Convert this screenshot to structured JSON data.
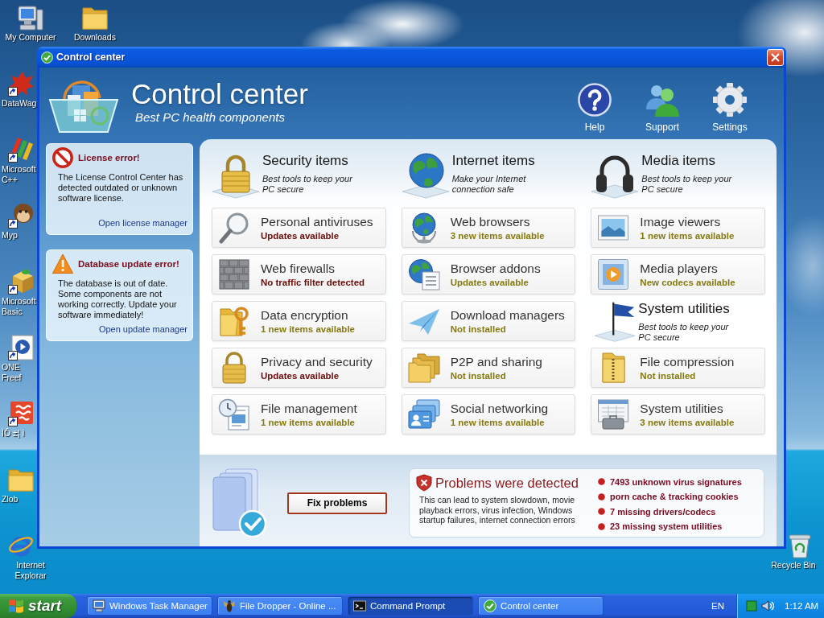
{
  "desktop": {
    "left_icons": [
      {
        "kind": "computer",
        "lines": [
          "My Computer"
        ]
      },
      {
        "kind": "splash",
        "lines": [
          "DataWag"
        ]
      },
      {
        "kind": "blocks",
        "lines": [
          "Microsoft",
          "C++"
        ]
      },
      {
        "kind": "monkey",
        "lines": [
          "Myp"
        ]
      },
      {
        "kind": "package",
        "lines": [
          "Microsoft",
          "Basic"
        ]
      },
      {
        "kind": "disc",
        "lines": [
          "ONE",
          "Freef"
        ]
      },
      {
        "kind": "tile",
        "lines": [
          "ÌÔ ±¦ ì"
        ]
      },
      {
        "kind": "folder",
        "lines": [
          "Zlob"
        ]
      },
      {
        "kind": "browser",
        "lines": [
          "Internet",
          "Explorar"
        ]
      }
    ],
    "top_icons": [
      {
        "kind": "folder",
        "lines": [
          "Downloads"
        ]
      }
    ],
    "right_icons": [
      {
        "kind": "bin",
        "lines": [
          "Recycle Bin"
        ]
      }
    ]
  },
  "window": {
    "title": "Control center",
    "header": {
      "title": "Control center",
      "subtitle": "Best PC health components",
      "tools": [
        {
          "kind": "help",
          "label": "Help"
        },
        {
          "kind": "support",
          "label": "Support"
        },
        {
          "kind": "settings",
          "label": "Settings"
        }
      ]
    },
    "alerts": [
      {
        "kind": "error",
        "title": "License error!",
        "text": "The License Control Center has detected outdated or unknown software license.",
        "link": "Open license manager"
      },
      {
        "kind": "warning",
        "title": "Database update error!",
        "text": "The database is out of date. Some components are not working correctly. Update your software immediately!",
        "link": "Open update manager"
      }
    ],
    "columns": [
      {
        "sections": [
          {
            "kind": "security",
            "title": "Security items",
            "description": "Best tools to keep your PC secure",
            "items": [
              {
                "kind": "antivirus",
                "name": "Personal antiviruses",
                "status": "Updates available",
                "color": "#6e0c0c"
              },
              {
                "kind": "firewall",
                "name": "Web firewalls",
                "status": "No traffic filter detected",
                "color": "#6e0c0c"
              },
              {
                "kind": "encryption",
                "name": "Data encryption",
                "status": "1 new items available",
                "color": "#857a10"
              },
              {
                "kind": "privacy",
                "name": "Privacy and security",
                "status": "Updates available",
                "color": "#6e0c0c"
              },
              {
                "kind": "files",
                "name": "File management",
                "status": "1 new items available",
                "color": "#857a10"
              }
            ]
          }
        ]
      },
      {
        "sections": [
          {
            "kind": "internet",
            "title": "Internet items",
            "description": "Make your Internet connection safe",
            "items": [
              {
                "kind": "browsers",
                "name": "Web browsers",
                "status": "3 new items available",
                "color": "#857a10"
              },
              {
                "kind": "addons",
                "name": "Browser addons",
                "status": "Updates available",
                "color": "#857a10"
              },
              {
                "kind": "downloads",
                "name": "Download managers",
                "status": "Not installed",
                "color": "#857a10"
              },
              {
                "kind": "p2p",
                "name": "P2P and sharing",
                "status": "Not installed",
                "color": "#857a10"
              },
              {
                "kind": "social",
                "name": "Social networking",
                "status": "1 new items available",
                "color": "#857a10"
              }
            ]
          }
        ]
      },
      {
        "sections": [
          {
            "kind": "media",
            "title": "Media items",
            "description": "Best tools to keep your PC secure",
            "items": [
              {
                "kind": "images",
                "name": "Image viewers",
                "status": "1 new items available",
                "color": "#857a10"
              },
              {
                "kind": "players",
                "name": "Media players",
                "status": "New codecs available",
                "color": "#857a10"
              }
            ]
          },
          {
            "kind": "system",
            "title": "System utilities",
            "description": "Best tools to keep your PC secure",
            "items": [
              {
                "kind": "compression",
                "name": "File compression",
                "status": "Not installed",
                "color": "#857a10"
              },
              {
                "kind": "utilities",
                "name": "System utilities",
                "status": "3 new items available",
                "color": "#857a10"
              }
            ]
          }
        ]
      }
    ],
    "problems": {
      "button": "Fix problems",
      "title": "Problems were detected",
      "description": "This can lead to system slowdown, movie playback errors, virus infection, Windows startup failures, internet connection errors",
      "findings": [
        "7493 unknown virus signatures",
        "porn cache & tracking cookies",
        "7 missing drivers/codecs",
        "23 missing system utilities"
      ]
    }
  },
  "taskbar": {
    "start": "start",
    "tasks": [
      {
        "kind": "monitor",
        "label": "Windows Task Manager",
        "selected": false
      },
      {
        "kind": "bug",
        "label": "File Dropper - Online ...",
        "selected": false
      },
      {
        "kind": "console",
        "label": "Command Prompt",
        "selected": true
      },
      {
        "kind": "check",
        "label": "Control center",
        "selected": false
      }
    ],
    "language": "EN",
    "clock": "1:12 AM"
  }
}
